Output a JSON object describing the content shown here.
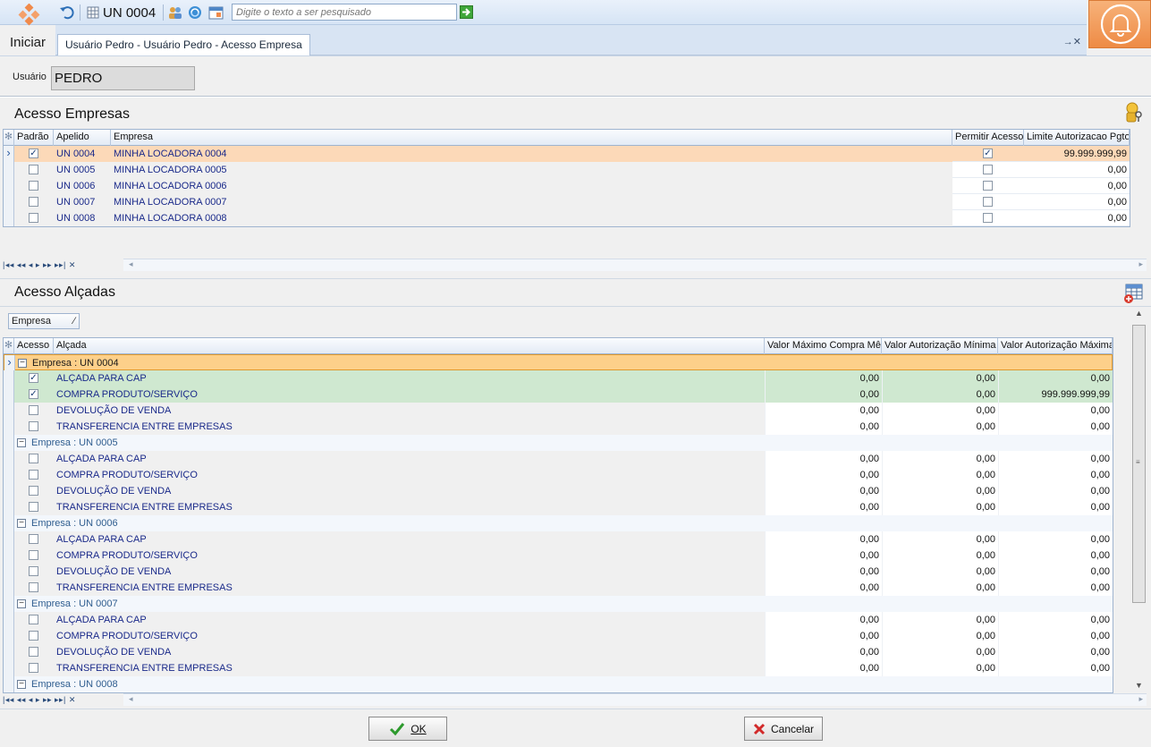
{
  "toolbar": {
    "unit_label": "UN 0004",
    "search_placeholder": "Digite o texto a ser pesquisado",
    "start_label": "Iniciar"
  },
  "tab": {
    "label": "Usuário Pedro - Usuário Pedro - Acesso Empresa",
    "close_label": "→✕"
  },
  "user": {
    "label": "Usuário",
    "value": "PEDRO"
  },
  "acesso_empresas": {
    "title": "Acesso Empresas",
    "columns": [
      "Padrão",
      "Apelido",
      "Empresa",
      "Permitir Acesso",
      "Limite Autorizacao Pgto"
    ],
    "rows": [
      {
        "padrao": true,
        "apelido": "UN 0004",
        "empresa": "MINHA LOCADORA 0004",
        "permitir": true,
        "limite": "99.999.999,99"
      },
      {
        "padrao": false,
        "apelido": "UN 0005",
        "empresa": "MINHA LOCADORA 0005",
        "permitir": false,
        "limite": "0,00"
      },
      {
        "padrao": false,
        "apelido": "UN 0006",
        "empresa": "MINHA LOCADORA 0006",
        "permitir": false,
        "limite": "0,00"
      },
      {
        "padrao": false,
        "apelido": "UN 0007",
        "empresa": "MINHA LOCADORA 0007",
        "permitir": false,
        "limite": "0,00"
      },
      {
        "padrao": false,
        "apelido": "UN 0008",
        "empresa": "MINHA LOCADORA 0008",
        "permitir": false,
        "limite": "0,00"
      }
    ]
  },
  "acesso_alcadas": {
    "title": "Acesso Alçadas",
    "group_chip": "Empresa",
    "columns": [
      "Acesso",
      "Alçada",
      "Valor Máximo Compra Mês",
      "Valor Autorização Mínima",
      "Valor Autorização Máxima"
    ],
    "groups": [
      {
        "label": "Empresa : UN 0004",
        "rows": [
          {
            "acesso": true,
            "alcada": "ALÇADA PARA CAP",
            "max_mes": "0,00",
            "min": "0,00",
            "max": "0,00"
          },
          {
            "acesso": true,
            "alcada": "COMPRA PRODUTO/SERVIÇO",
            "max_mes": "0,00",
            "min": "0,00",
            "max": "999.999.999,99"
          },
          {
            "acesso": false,
            "alcada": "DEVOLUÇÃO DE VENDA",
            "max_mes": "0,00",
            "min": "0,00",
            "max": "0,00"
          },
          {
            "acesso": false,
            "alcada": "TRANSFERENCIA ENTRE EMPRESAS",
            "max_mes": "0,00",
            "min": "0,00",
            "max": "0,00"
          }
        ]
      },
      {
        "label": "Empresa : UN 0005",
        "rows": [
          {
            "acesso": false,
            "alcada": "ALÇADA PARA CAP",
            "max_mes": "0,00",
            "min": "0,00",
            "max": "0,00"
          },
          {
            "acesso": false,
            "alcada": "COMPRA PRODUTO/SERVIÇO",
            "max_mes": "0,00",
            "min": "0,00",
            "max": "0,00"
          },
          {
            "acesso": false,
            "alcada": "DEVOLUÇÃO DE VENDA",
            "max_mes": "0,00",
            "min": "0,00",
            "max": "0,00"
          },
          {
            "acesso": false,
            "alcada": "TRANSFERENCIA ENTRE EMPRESAS",
            "max_mes": "0,00",
            "min": "0,00",
            "max": "0,00"
          }
        ]
      },
      {
        "label": "Empresa : UN 0006",
        "rows": [
          {
            "acesso": false,
            "alcada": "ALÇADA PARA CAP",
            "max_mes": "0,00",
            "min": "0,00",
            "max": "0,00"
          },
          {
            "acesso": false,
            "alcada": "COMPRA PRODUTO/SERVIÇO",
            "max_mes": "0,00",
            "min": "0,00",
            "max": "0,00"
          },
          {
            "acesso": false,
            "alcada": "DEVOLUÇÃO DE VENDA",
            "max_mes": "0,00",
            "min": "0,00",
            "max": "0,00"
          },
          {
            "acesso": false,
            "alcada": "TRANSFERENCIA ENTRE EMPRESAS",
            "max_mes": "0,00",
            "min": "0,00",
            "max": "0,00"
          }
        ]
      },
      {
        "label": "Empresa : UN 0007",
        "rows": [
          {
            "acesso": false,
            "alcada": "ALÇADA PARA CAP",
            "max_mes": "0,00",
            "min": "0,00",
            "max": "0,00"
          },
          {
            "acesso": false,
            "alcada": "COMPRA PRODUTO/SERVIÇO",
            "max_mes": "0,00",
            "min": "0,00",
            "max": "0,00"
          },
          {
            "acesso": false,
            "alcada": "DEVOLUÇÃO DE VENDA",
            "max_mes": "0,00",
            "min": "0,00",
            "max": "0,00"
          },
          {
            "acesso": false,
            "alcada": "TRANSFERENCIA ENTRE EMPRESAS",
            "max_mes": "0,00",
            "min": "0,00",
            "max": "0,00"
          }
        ]
      },
      {
        "label": "Empresa : UN 0008",
        "rows": []
      }
    ]
  },
  "buttons": {
    "ok": "OK",
    "cancel": "Cancelar"
  },
  "colors": {
    "selected_row": "#fcd9b8",
    "group_selected": "#fdd08a",
    "checked_row": "#cfe8d0",
    "accent_orange": "#ee8b45"
  }
}
